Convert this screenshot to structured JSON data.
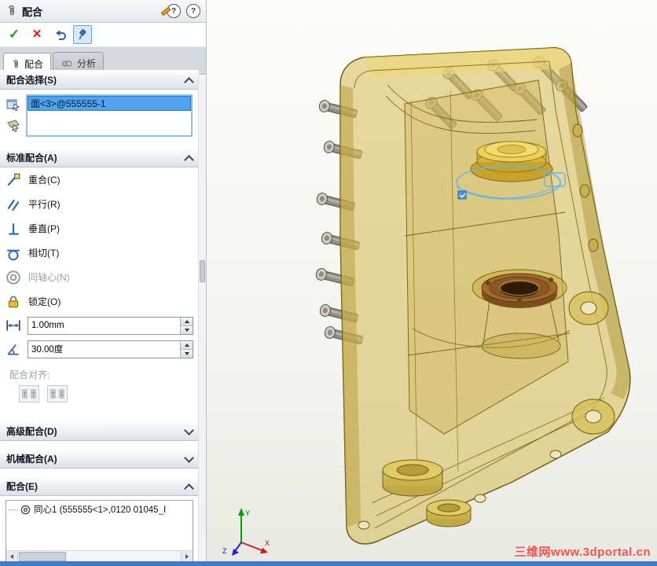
{
  "colors": {
    "selection_blue": "#52a2ee",
    "model_gold": "#d8bf5c",
    "bearing_bronze": "#a06a2c",
    "watermark_red": "#f4524e"
  },
  "panel": {
    "title": "配合",
    "icons": {
      "ok": "✓",
      "cancel": "×",
      "help": "?"
    },
    "tabs": [
      {
        "label": "配合"
      },
      {
        "label": "分析"
      }
    ],
    "mate_selections": {
      "title": "配合选择(S)",
      "items": [
        {
          "label": "面<3>@555555-1"
        }
      ]
    },
    "standard_mates": {
      "title": "标准配合(A)",
      "items": [
        {
          "label": "重合(C)"
        },
        {
          "label": "平行(R)"
        },
        {
          "label": "垂直(P)"
        },
        {
          "label": "相切(T)"
        },
        {
          "label": "同轴心(N)"
        },
        {
          "label": "锁定(O)"
        }
      ],
      "distance_value": "1.00mm",
      "angle_value": "30.00度",
      "alignment_label": "配合对齐:"
    },
    "advanced_mates_title": "高级配合(D)",
    "mechanical_mates_title": "机械配合(A)",
    "mates": {
      "title": "配合(E)",
      "items": [
        {
          "label": "同心1 (555555<1>,0120 01045_I"
        }
      ]
    }
  },
  "viewport": {
    "watermark": "三维网www.3dportal.cn",
    "triad": {
      "x": "X",
      "y": "Y",
      "z": "Z"
    }
  }
}
